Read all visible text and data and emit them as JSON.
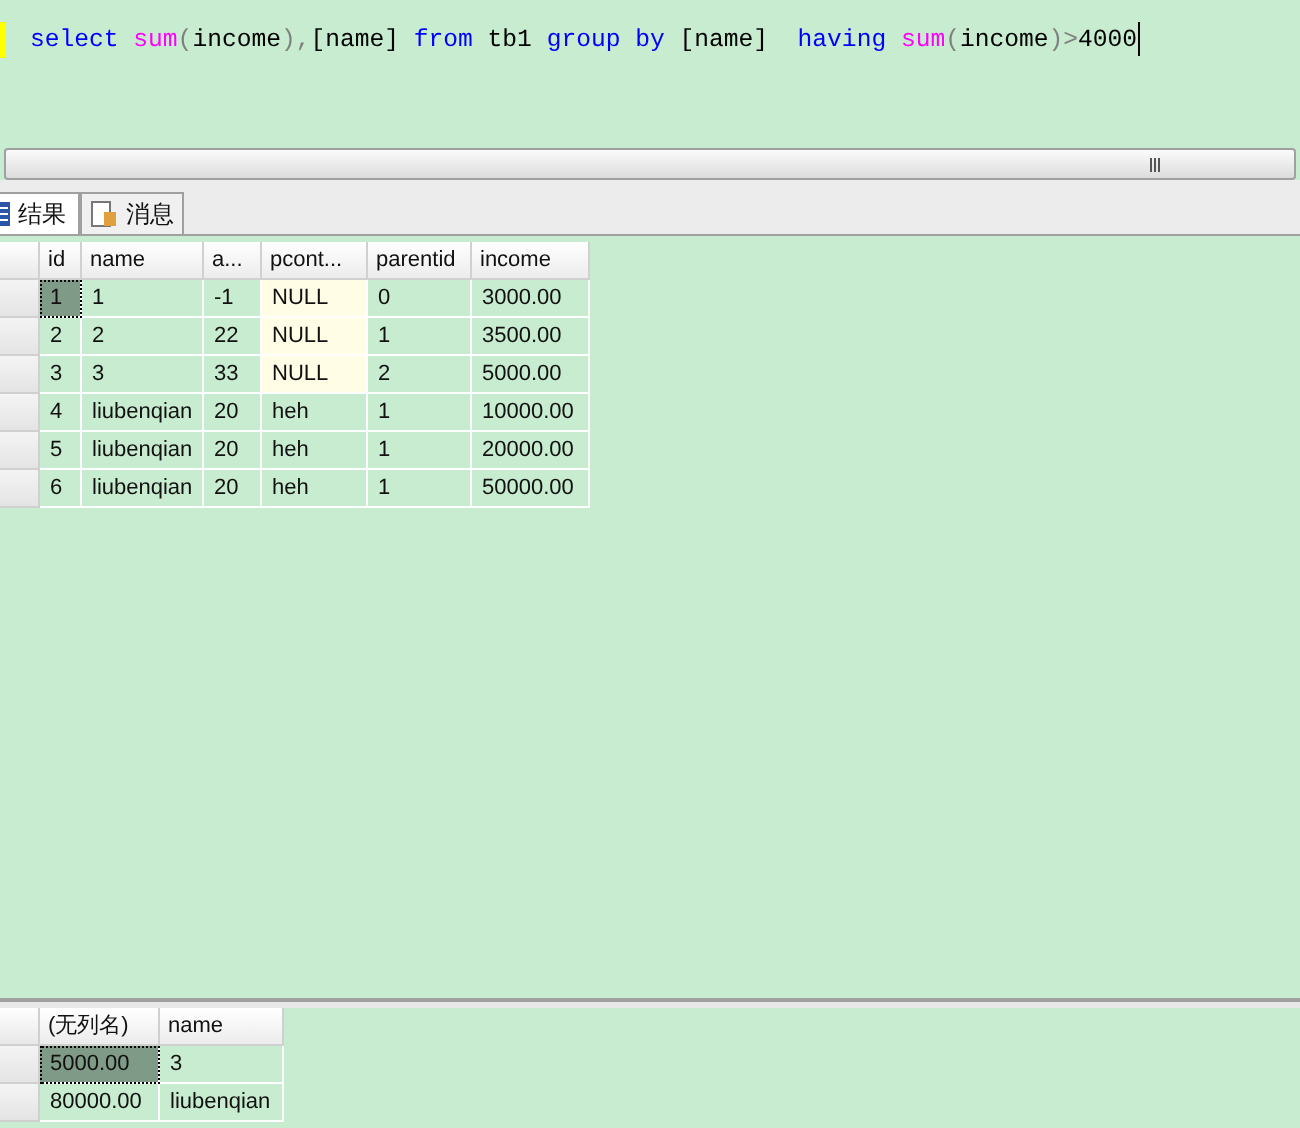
{
  "query": [
    {
      "kind": "keyword",
      "text": "select "
    },
    {
      "kind": "function",
      "text": "sum"
    },
    {
      "kind": "operator",
      "text": "("
    },
    {
      "kind": "plain",
      "text": "income"
    },
    {
      "kind": "operator",
      "text": "),"
    },
    {
      "kind": "plain",
      "text": "[name] "
    },
    {
      "kind": "keyword",
      "text": "from"
    },
    {
      "kind": "plain",
      "text": " tb1 "
    },
    {
      "kind": "keyword",
      "text": "group by"
    },
    {
      "kind": "plain",
      "text": " [name]  "
    },
    {
      "kind": "keyword",
      "text": "having "
    },
    {
      "kind": "function",
      "text": "sum"
    },
    {
      "kind": "operator",
      "text": "("
    },
    {
      "kind": "plain",
      "text": "income"
    },
    {
      "kind": "operator",
      "text": ")>"
    },
    {
      "kind": "plain",
      "text": "4000"
    }
  ],
  "tabs": [
    {
      "label": "结果",
      "selected": true
    },
    {
      "label": "消息",
      "selected": false
    }
  ],
  "results": [
    {
      "columns": [
        "id",
        "name",
        "a...",
        "pcont...",
        "parentid",
        "income"
      ],
      "rows": [
        [
          {
            "text": "1",
            "kind": "value",
            "selected": true
          },
          {
            "text": "1",
            "kind": "value",
            "selected": false
          },
          {
            "text": "-1",
            "kind": "value",
            "selected": false
          },
          {
            "text": "NULL",
            "kind": "null",
            "selected": false
          },
          {
            "text": "0",
            "kind": "value",
            "selected": false
          },
          {
            "text": "3000.00",
            "kind": "value",
            "selected": false
          }
        ],
        [
          {
            "text": "2",
            "kind": "value",
            "selected": false
          },
          {
            "text": "2",
            "kind": "value",
            "selected": false
          },
          {
            "text": "22",
            "kind": "value",
            "selected": false
          },
          {
            "text": "NULL",
            "kind": "null",
            "selected": false
          },
          {
            "text": "1",
            "kind": "value",
            "selected": false
          },
          {
            "text": "3500.00",
            "kind": "value",
            "selected": false
          }
        ],
        [
          {
            "text": "3",
            "kind": "value",
            "selected": false
          },
          {
            "text": "3",
            "kind": "value",
            "selected": false
          },
          {
            "text": "33",
            "kind": "value",
            "selected": false
          },
          {
            "text": "NULL",
            "kind": "null",
            "selected": false
          },
          {
            "text": "2",
            "kind": "value",
            "selected": false
          },
          {
            "text": "5000.00",
            "kind": "value",
            "selected": false
          }
        ],
        [
          {
            "text": "4",
            "kind": "value",
            "selected": false
          },
          {
            "text": "liubenqian",
            "kind": "value",
            "selected": false
          },
          {
            "text": "20",
            "kind": "value",
            "selected": false
          },
          {
            "text": "heh",
            "kind": "value",
            "selected": false
          },
          {
            "text": "1",
            "kind": "value",
            "selected": false
          },
          {
            "text": "10000.00",
            "kind": "value",
            "selected": false
          }
        ],
        [
          {
            "text": "5",
            "kind": "value",
            "selected": false
          },
          {
            "text": "liubenqian",
            "kind": "value",
            "selected": false
          },
          {
            "text": "20",
            "kind": "value",
            "selected": false
          },
          {
            "text": "heh",
            "kind": "value",
            "selected": false
          },
          {
            "text": "1",
            "kind": "value",
            "selected": false
          },
          {
            "text": "20000.00",
            "kind": "value",
            "selected": false
          }
        ],
        [
          {
            "text": "6",
            "kind": "value",
            "selected": false
          },
          {
            "text": "liubenqian",
            "kind": "value",
            "selected": false
          },
          {
            "text": "20",
            "kind": "value",
            "selected": false
          },
          {
            "text": "heh",
            "kind": "value",
            "selected": false
          },
          {
            "text": "1",
            "kind": "value",
            "selected": false
          },
          {
            "text": "50000.00",
            "kind": "value",
            "selected": false
          }
        ]
      ]
    },
    {
      "columns": [
        "(无列名)",
        "name"
      ],
      "rows": [
        [
          {
            "text": "5000.00",
            "kind": "value",
            "selected": true
          },
          {
            "text": "3",
            "kind": "value",
            "selected": false
          }
        ],
        [
          {
            "text": "80000.00",
            "kind": "value",
            "selected": false
          },
          {
            "text": "liubenqian",
            "kind": "value",
            "selected": false
          }
        ]
      ]
    }
  ]
}
